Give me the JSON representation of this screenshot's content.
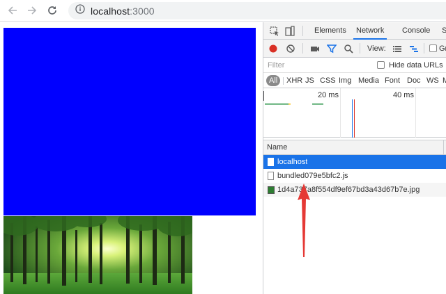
{
  "browser": {
    "url_host": "localhost",
    "url_port": ":3000",
    "icons": [
      "back-arrow-icon",
      "forward-arrow-icon",
      "reload-icon",
      "info-icon"
    ]
  },
  "page": {
    "blue_box_color": "#0000ff"
  },
  "devtools": {
    "tabs": [
      "Elements",
      "Network",
      "Console",
      "S"
    ],
    "active_tab": "Network",
    "toolbar": {
      "view_label": "View:",
      "group_label": "Gr"
    },
    "filter": {
      "placeholder": "Filter",
      "hide_data_urls": "Hide data URLs"
    },
    "types": [
      "All",
      "XHR",
      "JS",
      "CSS",
      "Img",
      "Media",
      "Font",
      "Doc",
      "WS",
      "M"
    ],
    "timeline": {
      "ticks": [
        "20 ms",
        "40 ms"
      ]
    },
    "table": {
      "name_header": "Name",
      "requests": [
        {
          "name": "localhost",
          "type": "doc"
        },
        {
          "name": "bundled079e5bfc2.js",
          "type": "script"
        },
        {
          "name": "1d4a737a8f554df9ef67bd3a43d67b7e.jpg",
          "type": "img"
        }
      ]
    }
  },
  "colors": {
    "accent": "#1a73e8",
    "record": "#d93025",
    "annotation_arrow": "#e53935"
  }
}
